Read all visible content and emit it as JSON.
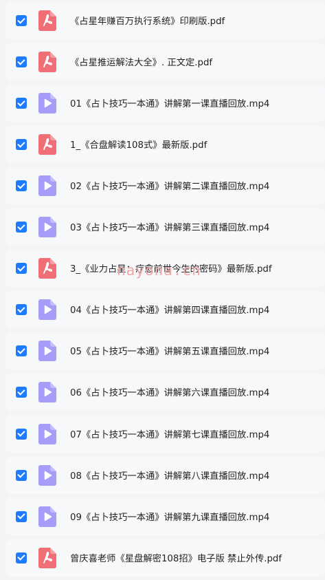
{
  "colors": {
    "accent": "#1f7bff",
    "pdf": "#f06e76",
    "video": "#a79cf8"
  },
  "watermark": "nayona.cn",
  "files": [
    {
      "name": "《占星年赚百万执行系统》印刷版.pdf",
      "type": "pdf",
      "checked": true
    },
    {
      "name": "《占星推运解法大全》. 正文定.pdf",
      "type": "pdf",
      "checked": true
    },
    {
      "name": "01《占卜技巧一本通》讲解第一课直播回放.mp4",
      "type": "video",
      "checked": true
    },
    {
      "name": "1_《合盘解读108式》最新版.pdf",
      "type": "pdf",
      "checked": true
    },
    {
      "name": "02《占卜技巧一本通》讲解第二课直播回放.mp4",
      "type": "video",
      "checked": true
    },
    {
      "name": "03《占卜技巧一本通》讲解第三课直播回放.mp4",
      "type": "video",
      "checked": true
    },
    {
      "name": "3_《业力占星：疗愈前世今生的密码》最新版.pdf",
      "type": "pdf",
      "checked": true
    },
    {
      "name": "04《占卜技巧一本通》讲解第四课直播回放.mp4",
      "type": "video",
      "checked": true
    },
    {
      "name": "05《占卜技巧一本通》讲解第五课直播回放.mp4",
      "type": "video",
      "checked": true
    },
    {
      "name": "06《占卜技巧一本通》讲解第六课直播回放.mp4",
      "type": "video",
      "checked": true
    },
    {
      "name": "07《占卜技巧一本通》讲解第七课直播回放.mp4",
      "type": "video",
      "checked": true
    },
    {
      "name": "08《占卜技巧一本通》讲解第八课直播回放.mp4",
      "type": "video",
      "checked": true
    },
    {
      "name": "09《占卜技巧一本通》讲解第九课直播回放.mp4",
      "type": "video",
      "checked": true
    },
    {
      "name": "曾庆喜老师《星盘解密108招》电子版 禁止外传.pdf",
      "type": "pdf",
      "checked": true
    }
  ]
}
